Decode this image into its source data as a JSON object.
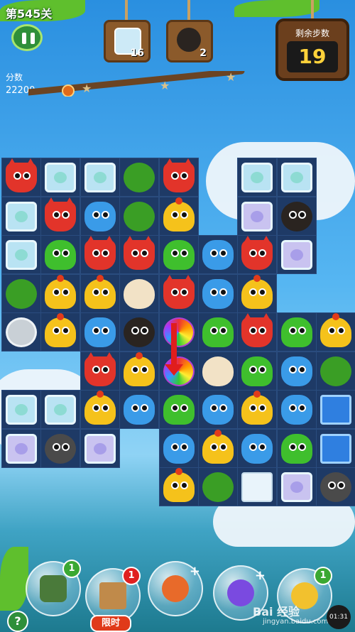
{
  "header": {
    "level_title": "第545关",
    "score_label": "分数",
    "score_value": "22200",
    "moves_label": "剩余步数",
    "moves_value": "19"
  },
  "goals": [
    {
      "icon": "ice-block-icon",
      "count": "16"
    },
    {
      "icon": "soot-ball-icon",
      "count": "2"
    }
  ],
  "boosters": [
    {
      "name": "shuffle-booster",
      "badge": "1"
    },
    {
      "name": "hammer-booster",
      "badge": "1",
      "tag": "限时"
    },
    {
      "name": "extra-moves-booster",
      "badge": "+"
    },
    {
      "name": "swap-booster",
      "badge": "+"
    },
    {
      "name": "star-booster",
      "badge": "1"
    }
  ],
  "help_label": "?",
  "watermark": {
    "brand": "Bai 经验",
    "url": "jingyan.baidu.com",
    "time": "01:31"
  },
  "colors": {
    "board": "#1e3a66",
    "moves_digits": "#ffd23a",
    "arrow": "#e01d1d"
  },
  "board": {
    "cols": 9,
    "rows": 9,
    "pieces": [
      [
        "fox",
        "ice",
        "ice",
        "bush",
        "fox",
        null,
        "ice",
        "ice",
        null
      ],
      [
        "ice",
        "fox",
        "hippo",
        "bush",
        "chick",
        null,
        "ice.v",
        "soot",
        null
      ],
      [
        "ice",
        "frog",
        "fox",
        "fox",
        "frog",
        "hippo",
        "fox",
        "ice.v",
        null
      ],
      [
        "bush",
        "chick",
        "chick",
        "egg",
        "fox",
        "hippo",
        "chick",
        null,
        null
      ],
      [
        "coin",
        "chick",
        "hippo",
        "soot",
        "rainbow",
        "frog",
        "fox",
        "frog",
        "chick"
      ],
      [
        null,
        null,
        "fox",
        "chick",
        "rainbow",
        "egg",
        "frog",
        "hippo",
        "bush"
      ],
      [
        "ice",
        "ice",
        "chick",
        "hippo",
        "frog",
        "hippo",
        "chick",
        "hippo",
        "bluegem"
      ],
      [
        "ice.v",
        "soot.g",
        "ice.v",
        null,
        "hippo",
        "chick",
        "hippo",
        "frog",
        "bluegem"
      ],
      [
        null,
        null,
        null,
        null,
        "chick",
        "bush",
        "plain",
        "ice.v",
        "soot.g"
      ]
    ]
  }
}
